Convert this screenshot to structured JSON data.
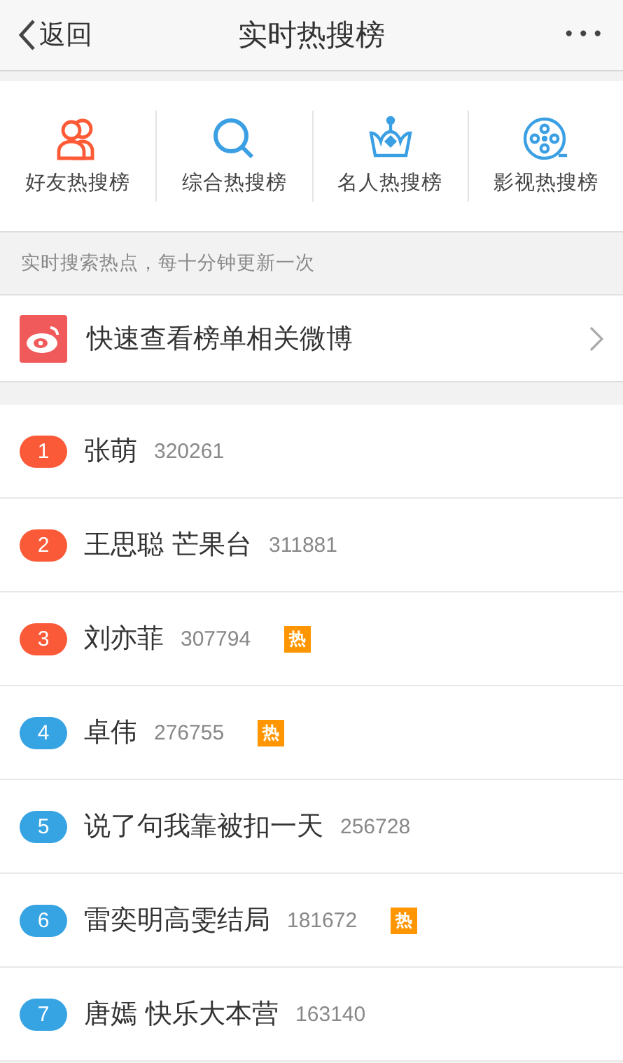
{
  "nav": {
    "back": "返回",
    "title": "实时热搜榜",
    "more": "•••"
  },
  "categories": [
    {
      "label": "好友热搜榜",
      "color": "#ff5a36"
    },
    {
      "label": "综合热搜榜",
      "color": "#3b9fe3"
    },
    {
      "label": "名人热搜榜",
      "color": "#3b9fe3"
    },
    {
      "label": "影视热搜榜",
      "color": "#3b9fe3"
    }
  ],
  "note": "实时搜索热点，每十分钟更新一次",
  "quick_link": {
    "label": "快速查看榜单相关微博"
  },
  "ranking": [
    {
      "rank": "1",
      "color": "#fa5a38",
      "title": "张萌",
      "count": "320261"
    },
    {
      "rank": "2",
      "color": "#fa5a38",
      "title": "王思聪 芒果台",
      "count": "311881"
    },
    {
      "rank": "3",
      "color": "#fa5a38",
      "title": "刘亦菲",
      "count": "307794",
      "tag": "热"
    },
    {
      "rank": "4",
      "color": "#36a3e3",
      "title": "卓伟",
      "count": "276755",
      "tag": "热"
    },
    {
      "rank": "5",
      "color": "#36a3e3",
      "title": "说了句我靠被扣一天",
      "count": "256728"
    },
    {
      "rank": "6",
      "color": "#36a3e3",
      "title": "雷奕明高雯结局",
      "count": "181672",
      "tag": "热"
    },
    {
      "rank": "7",
      "color": "#36a3e3",
      "title": "唐嫣 快乐大本营",
      "count": "163140"
    }
  ]
}
